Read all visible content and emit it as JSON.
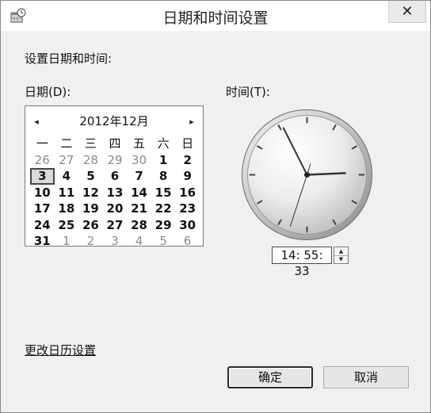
{
  "window": {
    "title": "日期和时间设置",
    "icon": "calendar-clock-icon",
    "close_label": "✕"
  },
  "main": {
    "heading": "设置日期和时间:",
    "date_label": "日期(D):",
    "time_label": "时间(T):"
  },
  "calendar": {
    "prev_label": "◂",
    "next_label": "▸",
    "month_title": "2012年12月",
    "weekdays": [
      "一",
      "二",
      "三",
      "四",
      "五",
      "六",
      "日"
    ],
    "weeks": [
      [
        {
          "d": "26",
          "m": "other"
        },
        {
          "d": "27",
          "m": "other"
        },
        {
          "d": "28",
          "m": "other"
        },
        {
          "d": "29",
          "m": "other"
        },
        {
          "d": "30",
          "m": "other"
        },
        {
          "d": "1",
          "m": "current"
        },
        {
          "d": "2",
          "m": "current"
        }
      ],
      [
        {
          "d": "3",
          "m": "selected"
        },
        {
          "d": "4",
          "m": "current"
        },
        {
          "d": "5",
          "m": "current"
        },
        {
          "d": "6",
          "m": "current"
        },
        {
          "d": "7",
          "m": "current"
        },
        {
          "d": "8",
          "m": "current"
        },
        {
          "d": "9",
          "m": "current"
        }
      ],
      [
        {
          "d": "10",
          "m": "current"
        },
        {
          "d": "11",
          "m": "current"
        },
        {
          "d": "12",
          "m": "current"
        },
        {
          "d": "13",
          "m": "current"
        },
        {
          "d": "14",
          "m": "current"
        },
        {
          "d": "15",
          "m": "current"
        },
        {
          "d": "16",
          "m": "current"
        }
      ],
      [
        {
          "d": "17",
          "m": "current"
        },
        {
          "d": "18",
          "m": "current"
        },
        {
          "d": "19",
          "m": "current"
        },
        {
          "d": "20",
          "m": "current"
        },
        {
          "d": "21",
          "m": "current"
        },
        {
          "d": "22",
          "m": "current"
        },
        {
          "d": "23",
          "m": "current"
        }
      ],
      [
        {
          "d": "24",
          "m": "current"
        },
        {
          "d": "25",
          "m": "current"
        },
        {
          "d": "26",
          "m": "current"
        },
        {
          "d": "27",
          "m": "current"
        },
        {
          "d": "28",
          "m": "current"
        },
        {
          "d": "29",
          "m": "current"
        },
        {
          "d": "30",
          "m": "current"
        }
      ],
      [
        {
          "d": "31",
          "m": "current"
        },
        {
          "d": "1",
          "m": "other"
        },
        {
          "d": "2",
          "m": "other"
        },
        {
          "d": "3",
          "m": "other"
        },
        {
          "d": "4",
          "m": "other"
        },
        {
          "d": "5",
          "m": "other"
        },
        {
          "d": "6",
          "m": "other"
        }
      ]
    ]
  },
  "time": {
    "value": "14: 55: 33",
    "clock": {
      "hours": 14,
      "minutes": 55,
      "seconds": 33
    }
  },
  "footer": {
    "calendar_link": "更改日历设置",
    "ok_label": "确定",
    "cancel_label": "取消"
  },
  "colors": {
    "dialog_background": "#f0f0f0",
    "titlebar_background": "#ffffff",
    "clock_hand": "#333333"
  }
}
